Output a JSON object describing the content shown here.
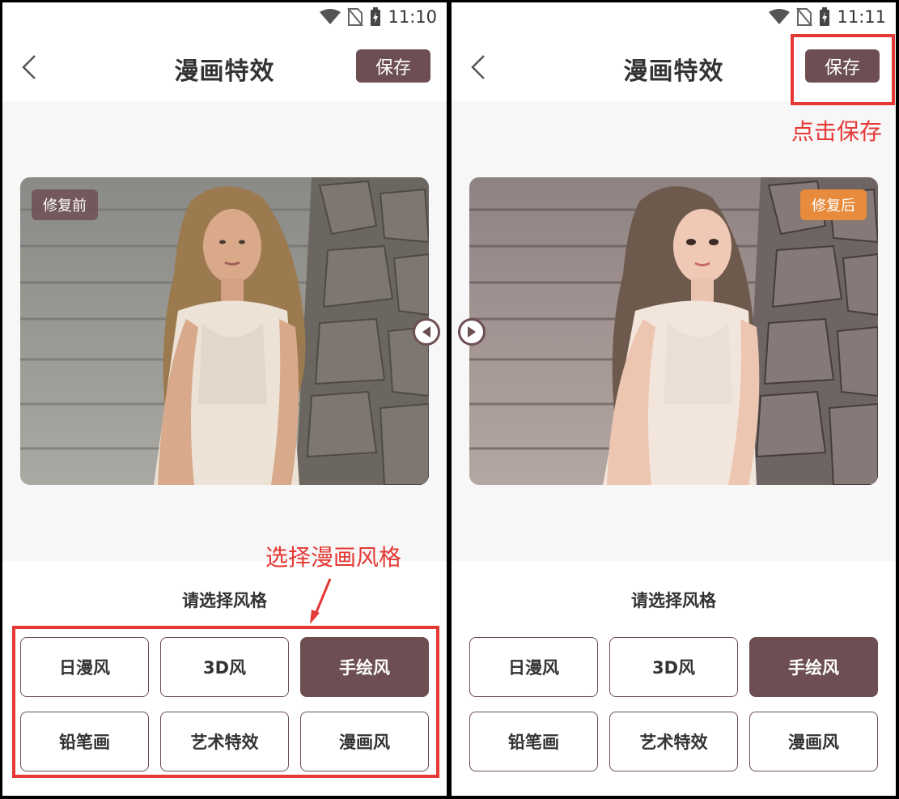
{
  "panels": [
    {
      "status": {
        "time": "11:10"
      },
      "header": {
        "title": "漫画特效",
        "save_label": "保存"
      },
      "preview": {
        "badge": "修复前"
      },
      "style_label": "请选择风格",
      "styles": [
        "日漫风",
        "3D风",
        "手绘风",
        "铅笔画",
        "艺术特效",
        "漫画风"
      ],
      "selected_style": "手绘风",
      "annotation": "选择漫画风格"
    },
    {
      "status": {
        "time": "11:11"
      },
      "header": {
        "title": "漫画特效",
        "save_label": "保存"
      },
      "preview": {
        "badge": "修复后"
      },
      "style_label": "请选择风格",
      "styles": [
        "日漫风",
        "3D风",
        "手绘风",
        "铅笔画",
        "艺术特效",
        "漫画风"
      ],
      "selected_style": "手绘风",
      "annotation": "点击保存"
    }
  ],
  "colors": {
    "accent": "#6d4f53",
    "after_badge": "#e88b3c",
    "annotation": "#e53935"
  },
  "icons": [
    "wifi-icon",
    "no-sim-icon",
    "battery-charging-icon",
    "back-arrow-icon",
    "slider-handle-icon"
  ]
}
